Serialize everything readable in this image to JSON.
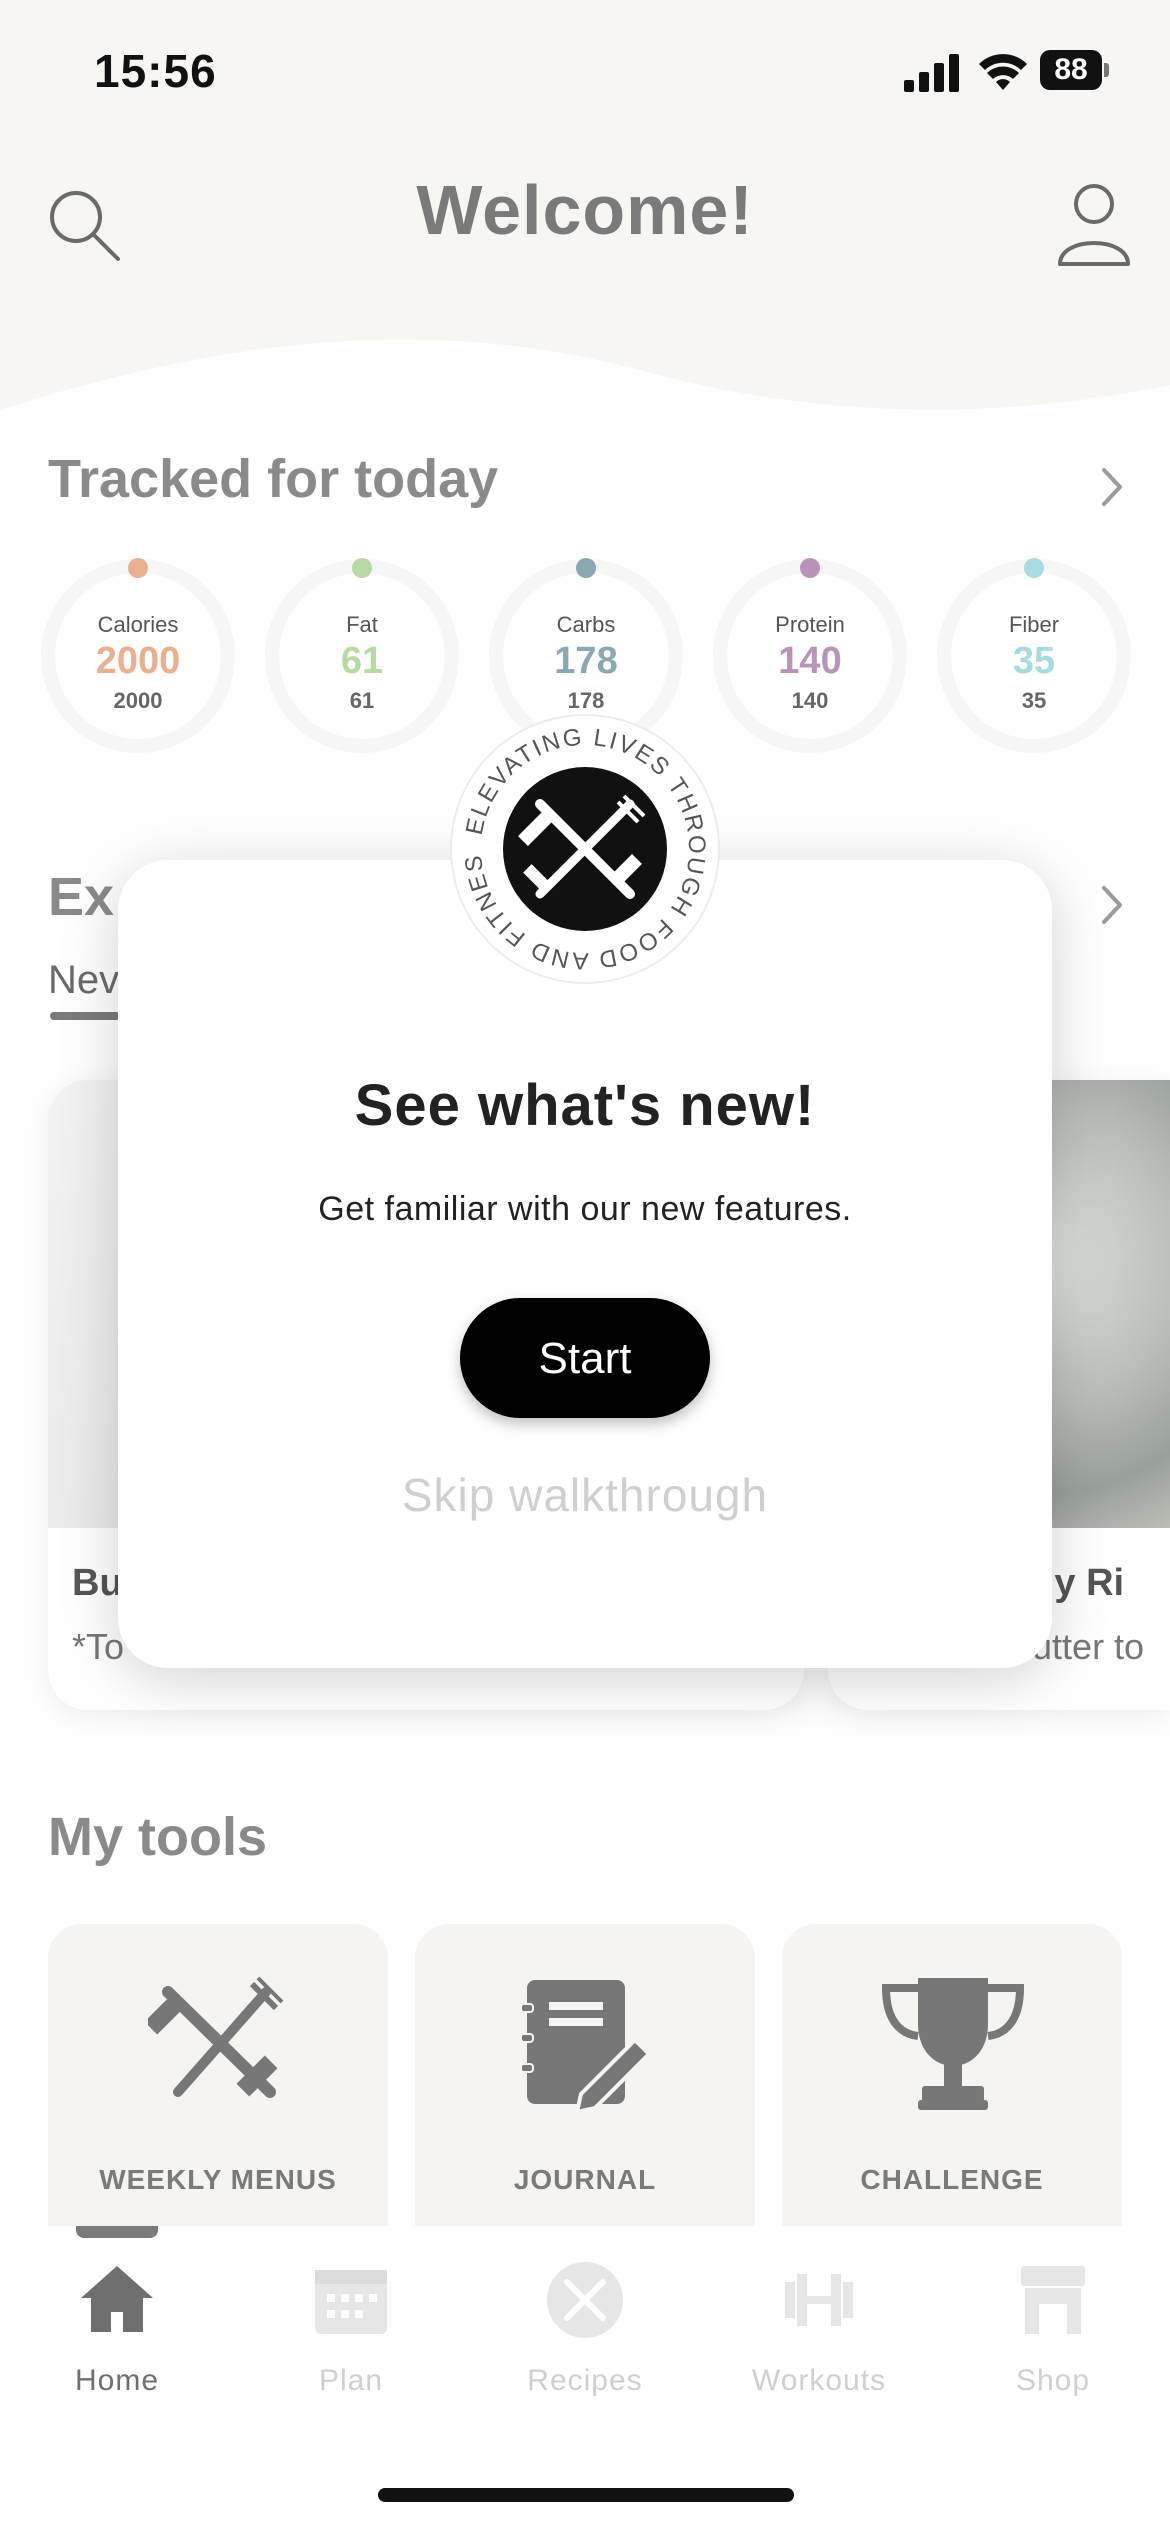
{
  "status": {
    "time": "15:56",
    "battery": "88"
  },
  "header": {
    "title": "Welcome!"
  },
  "tracked": {
    "title": "Tracked for today",
    "rings": [
      {
        "label": "Calories",
        "value": "2000",
        "goal": "2000",
        "color": "#e8b08e"
      },
      {
        "label": "Fat",
        "value": "61",
        "goal": "61",
        "color": "#b7d9a3"
      },
      {
        "label": "Carbs",
        "value": "178",
        "goal": "178",
        "color": "#8aa8b4"
      },
      {
        "label": "Protein",
        "value": "140",
        "goal": "140",
        "color": "#b894b8"
      },
      {
        "label": "Fiber",
        "value": "35",
        "goal": "35",
        "color": "#a6dce0"
      }
    ]
  },
  "explore": {
    "title_partial": "Ex",
    "tab_partial": "Nev",
    "card_left": {
      "title_partial": "Bu",
      "sub_partial": "*To"
    },
    "card_right": {
      "title_partial": "ndy Ri",
      "sub_partial": "butter to"
    }
  },
  "modal": {
    "badge_text": "ELEVATING LIVES THROUGH FOOD AND FITNESS",
    "title": "See what's new!",
    "subtitle": "Get familiar with our new features.",
    "start_label": "Start",
    "skip_label": "Skip walkthrough"
  },
  "tools": {
    "title": "My tools",
    "items": [
      {
        "label": "WEEKLY MENUS",
        "icon": "fork-dumbbell-icon"
      },
      {
        "label": "JOURNAL",
        "icon": "journal-icon"
      },
      {
        "label": "CHALLENGE",
        "icon": "trophy-icon"
      }
    ]
  },
  "nav": {
    "items": [
      {
        "label": "Home",
        "icon": "home-icon",
        "active": true
      },
      {
        "label": "Plan",
        "icon": "calendar-icon",
        "active": false
      },
      {
        "label": "Recipes",
        "icon": "recipes-icon",
        "active": false
      },
      {
        "label": "Workouts",
        "icon": "dumbbell-icon",
        "active": false
      },
      {
        "label": "Shop",
        "icon": "shop-icon",
        "active": false
      }
    ]
  }
}
